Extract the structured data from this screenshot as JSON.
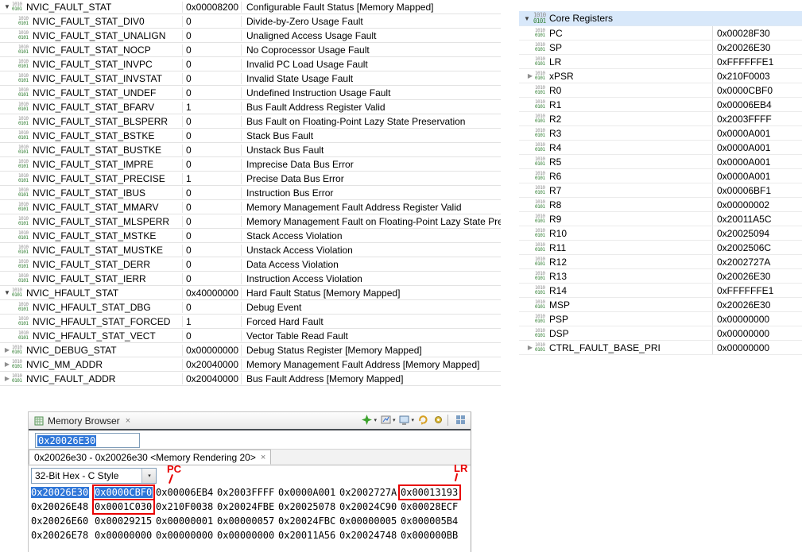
{
  "colors": {
    "selection_blue": "#2e76d8",
    "annotation_red": "#e80000",
    "group_header_highlight": "#d8e8fa"
  },
  "icons": {
    "expanded": "▼",
    "collapsed": "▶",
    "close": "×",
    "dropdown": "▾",
    "register_icon_lines": [
      "1010",
      "0101"
    ]
  },
  "fault_registers": {
    "rows": [
      {
        "name": "NVIC_FAULT_STAT",
        "value": "0x00008200",
        "desc": "Configurable Fault Status [Memory Mapped]",
        "indent": 0,
        "expander": "expanded"
      },
      {
        "name": "NVIC_FAULT_STAT_DIV0",
        "value": "0",
        "desc": "Divide-by-Zero Usage Fault",
        "indent": 1,
        "expander": "none"
      },
      {
        "name": "NVIC_FAULT_STAT_UNALIGN",
        "value": "0",
        "desc": "Unaligned Access Usage Fault",
        "indent": 1,
        "expander": "none"
      },
      {
        "name": "NVIC_FAULT_STAT_NOCP",
        "value": "0",
        "desc": "No Coprocessor Usage Fault",
        "indent": 1,
        "expander": "none"
      },
      {
        "name": "NVIC_FAULT_STAT_INVPC",
        "value": "0",
        "desc": "Invalid PC Load Usage Fault",
        "indent": 1,
        "expander": "none"
      },
      {
        "name": "NVIC_FAULT_STAT_INVSTAT",
        "value": "0",
        "desc": "Invalid State Usage Fault",
        "indent": 1,
        "expander": "none"
      },
      {
        "name": "NVIC_FAULT_STAT_UNDEF",
        "value": "0",
        "desc": "Undefined Instruction Usage Fault",
        "indent": 1,
        "expander": "none"
      },
      {
        "name": "NVIC_FAULT_STAT_BFARV",
        "value": "1",
        "desc": "Bus Fault Address Register Valid",
        "indent": 1,
        "expander": "none"
      },
      {
        "name": "NVIC_FAULT_STAT_BLSPERR",
        "value": "0",
        "desc": "Bus Fault on Floating-Point Lazy State Preservation",
        "indent": 1,
        "expander": "none"
      },
      {
        "name": "NVIC_FAULT_STAT_BSTKE",
        "value": "0",
        "desc": "Stack Bus Fault",
        "indent": 1,
        "expander": "none"
      },
      {
        "name": "NVIC_FAULT_STAT_BUSTKE",
        "value": "0",
        "desc": "Unstack Bus Fault",
        "indent": 1,
        "expander": "none"
      },
      {
        "name": "NVIC_FAULT_STAT_IMPRE",
        "value": "0",
        "desc": "Imprecise Data Bus Error",
        "indent": 1,
        "expander": "none"
      },
      {
        "name": "NVIC_FAULT_STAT_PRECISE",
        "value": "1",
        "desc": "Precise Data Bus Error",
        "indent": 1,
        "expander": "none"
      },
      {
        "name": "NVIC_FAULT_STAT_IBUS",
        "value": "0",
        "desc": "Instruction Bus Error",
        "indent": 1,
        "expander": "none"
      },
      {
        "name": "NVIC_FAULT_STAT_MMARV",
        "value": "0",
        "desc": "Memory Management Fault Address Register Valid",
        "indent": 1,
        "expander": "none"
      },
      {
        "name": "NVIC_FAULT_STAT_MLSPERR",
        "value": "0",
        "desc": "Memory Management Fault on Floating-Point Lazy State Preservation",
        "indent": 1,
        "expander": "none"
      },
      {
        "name": "NVIC_FAULT_STAT_MSTKE",
        "value": "0",
        "desc": "Stack Access Violation",
        "indent": 1,
        "expander": "none"
      },
      {
        "name": "NVIC_FAULT_STAT_MUSTKE",
        "value": "0",
        "desc": "Unstack Access Violation",
        "indent": 1,
        "expander": "none"
      },
      {
        "name": "NVIC_FAULT_STAT_DERR",
        "value": "0",
        "desc": "Data Access Violation",
        "indent": 1,
        "expander": "none"
      },
      {
        "name": "NVIC_FAULT_STAT_IERR",
        "value": "0",
        "desc": "Instruction Access Violation",
        "indent": 1,
        "expander": "none"
      },
      {
        "name": "NVIC_HFAULT_STAT",
        "value": "0x40000000",
        "desc": "Hard Fault Status [Memory Mapped]",
        "indent": 0,
        "expander": "expanded"
      },
      {
        "name": "NVIC_HFAULT_STAT_DBG",
        "value": "0",
        "desc": "Debug Event",
        "indent": 1,
        "expander": "none"
      },
      {
        "name": "NVIC_HFAULT_STAT_FORCED",
        "value": "1",
        "desc": "Forced Hard Fault",
        "indent": 1,
        "expander": "none"
      },
      {
        "name": "NVIC_HFAULT_STAT_VECT",
        "value": "0",
        "desc": "Vector Table Read Fault",
        "indent": 1,
        "expander": "none"
      },
      {
        "name": "NVIC_DEBUG_STAT",
        "value": "0x00000000",
        "desc": "Debug Status Register [Memory Mapped]",
        "indent": 0,
        "expander": "collapsed"
      },
      {
        "name": "NVIC_MM_ADDR",
        "value": "0x20040000",
        "desc": "Memory Management Fault Address [Memory Mapped]",
        "indent": 0,
        "expander": "collapsed"
      },
      {
        "name": "NVIC_FAULT_ADDR",
        "value": "0x20040000",
        "desc": "Bus Fault Address [Memory Mapped]",
        "indent": 0,
        "expander": "collapsed"
      }
    ]
  },
  "core_registers": {
    "title": "Core Registers",
    "rows": [
      {
        "name": "PC",
        "value": "0x00028F30",
        "expander": "none"
      },
      {
        "name": "SP",
        "value": "0x20026E30",
        "expander": "none"
      },
      {
        "name": "LR",
        "value": "0xFFFFFFE1",
        "expander": "none"
      },
      {
        "name": "xPSR",
        "value": "0x210F0003",
        "expander": "collapsed"
      },
      {
        "name": "R0",
        "value": "0x0000CBF0",
        "expander": "none"
      },
      {
        "name": "R1",
        "value": "0x00006EB4",
        "expander": "none"
      },
      {
        "name": "R2",
        "value": "0x2003FFFF",
        "expander": "none"
      },
      {
        "name": "R3",
        "value": "0x0000A001",
        "expander": "none"
      },
      {
        "name": "R4",
        "value": "0x0000A001",
        "expander": "none"
      },
      {
        "name": "R5",
        "value": "0x0000A001",
        "expander": "none"
      },
      {
        "name": "R6",
        "value": "0x0000A001",
        "expander": "none"
      },
      {
        "name": "R7",
        "value": "0x00006BF1",
        "expander": "none"
      },
      {
        "name": "R8",
        "value": "0x00000002",
        "expander": "none"
      },
      {
        "name": "R9",
        "value": "0x20011A5C",
        "expander": "none"
      },
      {
        "name": "R10",
        "value": "0x20025094",
        "expander": "none"
      },
      {
        "name": "R11",
        "value": "0x2002506C",
        "expander": "none"
      },
      {
        "name": "R12",
        "value": "0x2002727A",
        "expander": "none"
      },
      {
        "name": "R13",
        "value": "0x20026E30",
        "expander": "none"
      },
      {
        "name": "R14",
        "value": "0xFFFFFFE1",
        "expander": "none"
      },
      {
        "name": "MSP",
        "value": "0x20026E30",
        "expander": "none"
      },
      {
        "name": "PSP",
        "value": "0x00000000",
        "expander": "none"
      },
      {
        "name": "DSP",
        "value": "0x00000000",
        "expander": "none"
      },
      {
        "name": "CTRL_FAULT_BASE_PRI",
        "value": "0x00000000",
        "expander": "collapsed"
      }
    ]
  },
  "memory_browser": {
    "title": "Memory Browser",
    "toolbar_icon_names": [
      "new-rendering-icon",
      "export-memory-icon",
      "load-memory-icon",
      "refresh-icon",
      "settings-icon",
      "view-layout-icon"
    ],
    "address_input": "0x20026E30",
    "rendering_tab_label": "0x20026e30 - 0x20026e30 <Memory Rendering 20>",
    "format_dropdown": "32-Bit Hex - C Style",
    "annotations": {
      "pc": "PC",
      "lr": "LR"
    },
    "rows": [
      {
        "address": "0x20026E30",
        "address_selected": true,
        "values": [
          {
            "v": "0x0000CBF0",
            "selected": true,
            "boxed": true
          },
          {
            "v": "0x00006EB4"
          },
          {
            "v": "0x2003FFFF"
          },
          {
            "v": "0x0000A001"
          },
          {
            "v": "0x2002727A"
          },
          {
            "v": "0x00013193",
            "boxed": true
          }
        ]
      },
      {
        "address": "0x20026E48",
        "values": [
          {
            "v": "0x0001C030",
            "boxed": true
          },
          {
            "v": "0x210F0038"
          },
          {
            "v": "0x20024FBE"
          },
          {
            "v": "0x20025078"
          },
          {
            "v": "0x20024C90"
          },
          {
            "v": "0x00028ECF"
          }
        ]
      },
      {
        "address": "0x20026E60",
        "values": [
          {
            "v": "0x00029215"
          },
          {
            "v": "0x00000001"
          },
          {
            "v": "0x00000057"
          },
          {
            "v": "0x20024FBC"
          },
          {
            "v": "0x00000005"
          },
          {
            "v": "0x000005B4"
          }
        ]
      },
      {
        "address": "0x20026E78",
        "values": [
          {
            "v": "0x00000000"
          },
          {
            "v": "0x00000000"
          },
          {
            "v": "0x00000000"
          },
          {
            "v": "0x20011A56"
          },
          {
            "v": "0x20024748"
          },
          {
            "v": "0x000000BB"
          }
        ]
      }
    ]
  }
}
